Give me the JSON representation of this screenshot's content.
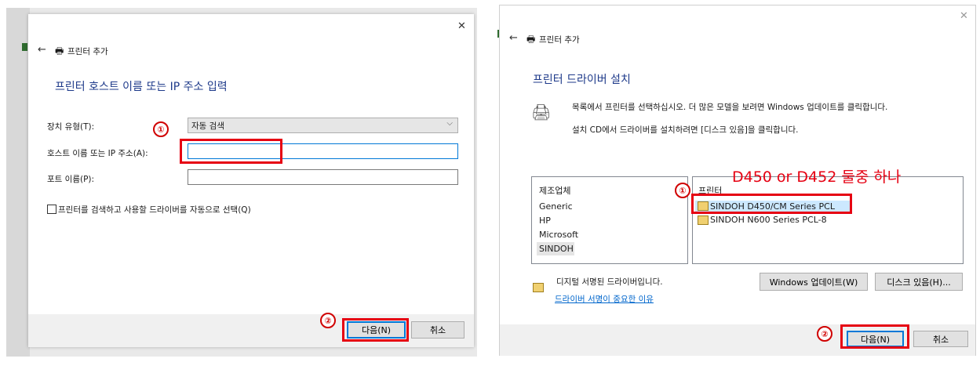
{
  "left": {
    "header": "프린터 추가",
    "heading": "프린터 호스트 이름 또는 IP 주소 입력",
    "device_type_label": "장치 유형(T):",
    "device_type_value": "자동 검색",
    "host_label": "호스트 이름 또는 IP 주소(A):",
    "host_value": "",
    "port_label": "포트 이름(P):",
    "port_value": "",
    "auto_select_label": "프린터를 검색하고 사용할 드라이버를 자동으로 선택(Q)",
    "next_button": "다음(N)",
    "cancel_button": "취소",
    "marker1": "①",
    "marker2": "②"
  },
  "right": {
    "header": "프린터 추가",
    "heading": "프린터 드라이버 설치",
    "description_line1": "목록에서 프린터를 선택하십시오. 더 많은 모델을 보려면 Windows 업데이트를 클릭합니다.",
    "description_line2": "설치 CD에서 드라이버를 설치하려면 [디스크 있음]을 클릭합니다.",
    "manufacturer_header": "제조업체",
    "manufacturers": [
      "Generic",
      "HP",
      "Microsoft",
      "SINDOH"
    ],
    "printer_header": "프린터",
    "printers": [
      "SINDOH D450/CM Series PCL",
      "SINDOH N600 Series PCL-8"
    ],
    "annotation": "D450 or D452 둘중 하나",
    "signed_text": "디지털 서명된 드라이버입니다.",
    "signing_link": "드라이버 서명이 중요한 이유",
    "windows_update_button": "Windows 업데이트(W)",
    "have_disk_button": "디스크 있음(H)...",
    "next_button": "다음(N)",
    "cancel_button": "취소",
    "marker1": "①",
    "marker2": "②"
  },
  "colors": {
    "heading": "#1e3a8a",
    "annotation_red": "#e60012",
    "link": "#0066cc",
    "selection": "#cce8ff"
  }
}
